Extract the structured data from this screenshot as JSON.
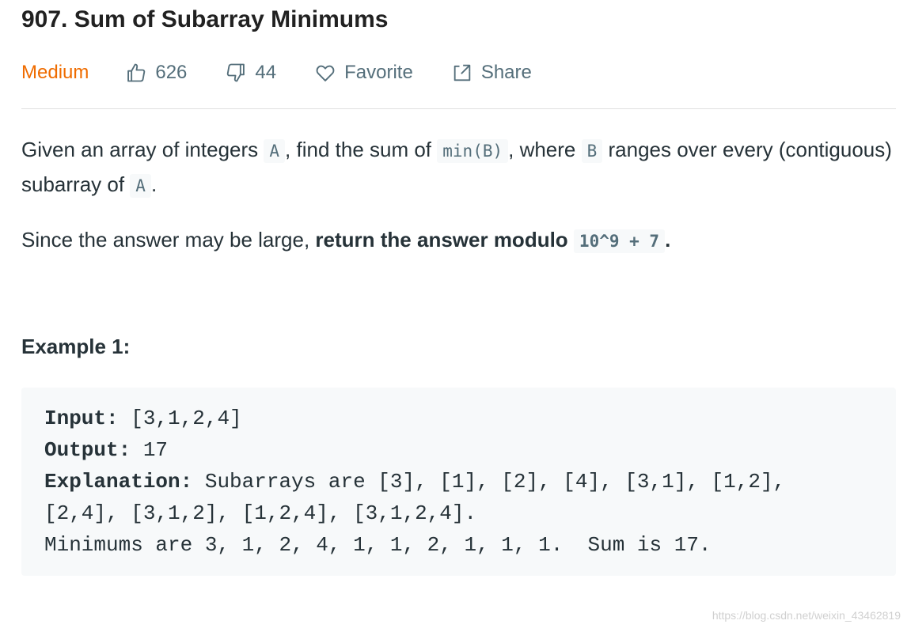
{
  "problem": {
    "title": "907. Sum of Subarray Minimums",
    "difficulty": "Medium"
  },
  "meta": {
    "likes": "626",
    "dislikes": "44",
    "favorite_label": "Favorite",
    "share_label": "Share"
  },
  "icons": {
    "like": "thumbs-up-icon",
    "dislike": "thumbs-down-icon",
    "favorite": "heart-icon",
    "share": "share-icon"
  },
  "description": {
    "p1_t1": "Given an array of integers ",
    "p1_c1": "A",
    "p1_t2": ", find the sum of ",
    "p1_c2": "min(B)",
    "p1_t3": ", where ",
    "p1_c3": "B",
    "p1_t4": " ranges over every (contiguous) subarray of ",
    "p1_c4": "A",
    "p1_t5": ".",
    "p2_t1": "Since the answer may be large, ",
    "p2_bold": "return the answer modulo ",
    "p2_c1": "10^9 + 7",
    "p2_t2": "."
  },
  "example": {
    "title": "Example 1:",
    "input_label": "Input:",
    "input_value": " [3,1,2,4]",
    "output_label": "Output:",
    "output_value": " 17",
    "explanation_label": "Explanation:",
    "explanation_line1": " Subarrays are [3], [1], [2], [4], [3,1], [1,2],",
    "explanation_line2": "[2,4], [3,1,2], [1,2,4], [3,1,2,4].",
    "explanation_line3": "Minimums are 3, 1, 2, 4, 1, 1, 2, 1, 1, 1.  Sum is 17."
  },
  "watermark": "https://blog.csdn.net/weixin_43462819",
  "colors": {
    "difficulty": "#ef6c00",
    "meta_text": "#546e7a",
    "code_bg": "#f7f9fa",
    "divider": "#e0e0e0"
  }
}
